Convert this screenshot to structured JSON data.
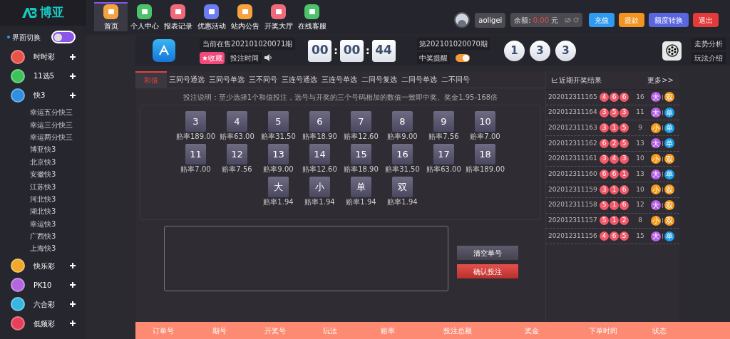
{
  "logo": {
    "text": "博亚"
  },
  "nav": [
    {
      "label": "首页",
      "selected": true,
      "color": "#f5a342"
    },
    {
      "label": "个人中心",
      "selected": false,
      "color": "#4cc36a"
    },
    {
      "label": "报表记录",
      "selected": false,
      "color": "#f06a7a"
    },
    {
      "label": "优惠活动",
      "selected": false,
      "color": "#6d7cf0"
    },
    {
      "label": "站内公告",
      "selected": false,
      "color": "#f7a23e"
    },
    {
      "label": "开奖大厅",
      "selected": false,
      "color": "#f06a7a"
    },
    {
      "label": "在线客服",
      "selected": false,
      "color": "#4cc36a"
    }
  ],
  "user": {
    "name": "aoligei",
    "balance_label": "余额:",
    "balance": "0.00",
    "currency": "元",
    "buttons": [
      {
        "label": "充值",
        "color": "#2f9af0"
      },
      {
        "label": "提款",
        "color": "#f39320"
      },
      {
        "label": "额度转换",
        "color": "#5a66e0"
      },
      {
        "label": "退出",
        "color": "#e33a3a"
      }
    ]
  },
  "sidebar": {
    "switch_label": "界面切换",
    "switch_on": false,
    "items": [
      {
        "label": "时时彩",
        "color": "#e8534a"
      },
      {
        "label": "11选5",
        "color": "#3cc35a"
      },
      {
        "label": "快3",
        "color": "#2f8fe0",
        "children": [
          {
            "label": "幸运五分快三"
          },
          {
            "label": "幸运三分快三"
          },
          {
            "label": "幸运两分快三"
          },
          {
            "label": "博亚快3"
          },
          {
            "label": "北京快3"
          },
          {
            "label": "安徽快3"
          },
          {
            "label": "江苏快3"
          },
          {
            "label": "河北快3"
          },
          {
            "label": "湖北快3"
          },
          {
            "label": "幸运快3"
          },
          {
            "label": "广西快3"
          },
          {
            "label": "上海快3"
          }
        ]
      },
      {
        "label": "快乐彩",
        "color": "#f0a92a"
      },
      {
        "label": "PK10",
        "color": "#b466e0"
      },
      {
        "label": "六合彩",
        "color": "#38b6e0"
      },
      {
        "label": "低频彩",
        "color": "#e8405a"
      }
    ]
  },
  "game_header": {
    "current_issue": "当前在售202101020071期",
    "favorite": "★收藏",
    "bet_time": "投注时间",
    "timer": [
      "00",
      "00",
      "44"
    ],
    "timer_separator": ":",
    "last_issue": "第202101020070期",
    "win_alert": "中奖提醒",
    "win_alert_on": true,
    "last_numbers": [
      "1",
      "3",
      "3"
    ],
    "links": [
      "走势分析",
      "玩法介绍"
    ]
  },
  "bet": {
    "tabs": [
      {
        "label": "和值",
        "selected": true
      },
      {
        "label": "三同号通选",
        "selected": false
      },
      {
        "label": "三同号单选",
        "selected": false
      },
      {
        "label": "三不同号",
        "selected": false
      },
      {
        "label": "三连号通选",
        "selected": false
      },
      {
        "label": "三连号单选",
        "selected": false
      },
      {
        "label": "二同号复选",
        "selected": false
      },
      {
        "label": "二同号单选",
        "selected": false
      },
      {
        "label": "二不同号",
        "selected": false
      }
    ],
    "instruction": "投注说明：至少选择1个和值投注，选号与开奖的三个号码相加的数值一致即中奖。奖金1.95-168倍",
    "sums": [
      {
        "n": "3",
        "odds": "赔率189.00"
      },
      {
        "n": "4",
        "odds": "赔率63.00"
      },
      {
        "n": "5",
        "odds": "赔率31.50"
      },
      {
        "n": "6",
        "odds": "赔率18.90"
      },
      {
        "n": "7",
        "odds": "赔率12.60"
      },
      {
        "n": "8",
        "odds": "赔率9.00"
      },
      {
        "n": "9",
        "odds": "赔率7.56"
      },
      {
        "n": "10",
        "odds": "赔率7.00"
      },
      {
        "n": "11",
        "odds": "赔率7.00"
      },
      {
        "n": "12",
        "odds": "赔率7.56"
      },
      {
        "n": "13",
        "odds": "赔率9.00"
      },
      {
        "n": "14",
        "odds": "赔率12.60"
      },
      {
        "n": "15",
        "odds": "赔率18.90"
      },
      {
        "n": "16",
        "odds": "赔率31.50"
      },
      {
        "n": "17",
        "odds": "赔率63.00"
      },
      {
        "n": "18",
        "odds": "赔率189.00"
      }
    ],
    "specials": [
      {
        "n": "大",
        "odds": "赔率1.94"
      },
      {
        "n": "小",
        "odds": "赔率1.94"
      },
      {
        "n": "单",
        "odds": "赔率1.94"
      },
      {
        "n": "双",
        "odds": "赔率1.94"
      }
    ],
    "clear_button": "清空单号",
    "confirm_button": "确认投注"
  },
  "results": {
    "title": "近期开奖结果",
    "more": "更多>>",
    "rows": [
      {
        "issue": "202012311165",
        "balls": [
          "4",
          "6",
          "6"
        ],
        "sum": "16",
        "size": {
          "text": "大",
          "color": "#b65fe6"
        },
        "parity": {
          "text": "双",
          "color": "#f39a1e"
        }
      },
      {
        "issue": "202012311164",
        "balls": [
          "3",
          "5",
          "3"
        ],
        "sum": "11",
        "size": {
          "text": "大",
          "color": "#b65fe6"
        },
        "parity": {
          "text": "单",
          "color": "#1a9ee6"
        }
      },
      {
        "issue": "202012311163",
        "balls": [
          "3",
          "1",
          "5"
        ],
        "sum": "9",
        "size": {
          "text": "小",
          "color": "#f39a1e"
        },
        "parity": {
          "text": "单",
          "color": "#1a9ee6"
        }
      },
      {
        "issue": "202012311162",
        "balls": [
          "6",
          "2",
          "5"
        ],
        "sum": "13",
        "size": {
          "text": "大",
          "color": "#b65fe6"
        },
        "parity": {
          "text": "单",
          "color": "#1a9ee6"
        }
      },
      {
        "issue": "202012311161",
        "balls": [
          "3",
          "4",
          "3"
        ],
        "sum": "10",
        "size": {
          "text": "小",
          "color": "#f39a1e"
        },
        "parity": {
          "text": "双",
          "color": "#f39a1e"
        }
      },
      {
        "issue": "202012311160",
        "balls": [
          "6",
          "6",
          "1"
        ],
        "sum": "13",
        "size": {
          "text": "大",
          "color": "#b65fe6"
        },
        "parity": {
          "text": "单",
          "color": "#1a9ee6"
        }
      },
      {
        "issue": "202012311159",
        "balls": [
          "3",
          "1",
          "6"
        ],
        "sum": "10",
        "size": {
          "text": "小",
          "color": "#f39a1e"
        },
        "parity": {
          "text": "双",
          "color": "#f39a1e"
        }
      },
      {
        "issue": "202012311158",
        "balls": [
          "5",
          "1",
          "6"
        ],
        "sum": "12",
        "size": {
          "text": "大",
          "color": "#b65fe6"
        },
        "parity": {
          "text": "双",
          "color": "#f39a1e"
        }
      },
      {
        "issue": "202012311157",
        "balls": [
          "5",
          "1",
          "2"
        ],
        "sum": "8",
        "size": {
          "text": "小",
          "color": "#f39a1e"
        },
        "parity": {
          "text": "双",
          "color": "#f39a1e"
        }
      },
      {
        "issue": "202012311156",
        "balls": [
          "4",
          "6",
          "5"
        ],
        "sum": "15",
        "size": {
          "text": "大",
          "color": "#b65fe6"
        },
        "parity": {
          "text": "单",
          "color": "#1a9ee6"
        }
      }
    ]
  },
  "orders_table": {
    "columns": [
      "订单号",
      "期号",
      "开奖号",
      "玩法",
      "赔率",
      "投注总额",
      "奖金",
      "下单时间",
      "状态"
    ]
  }
}
